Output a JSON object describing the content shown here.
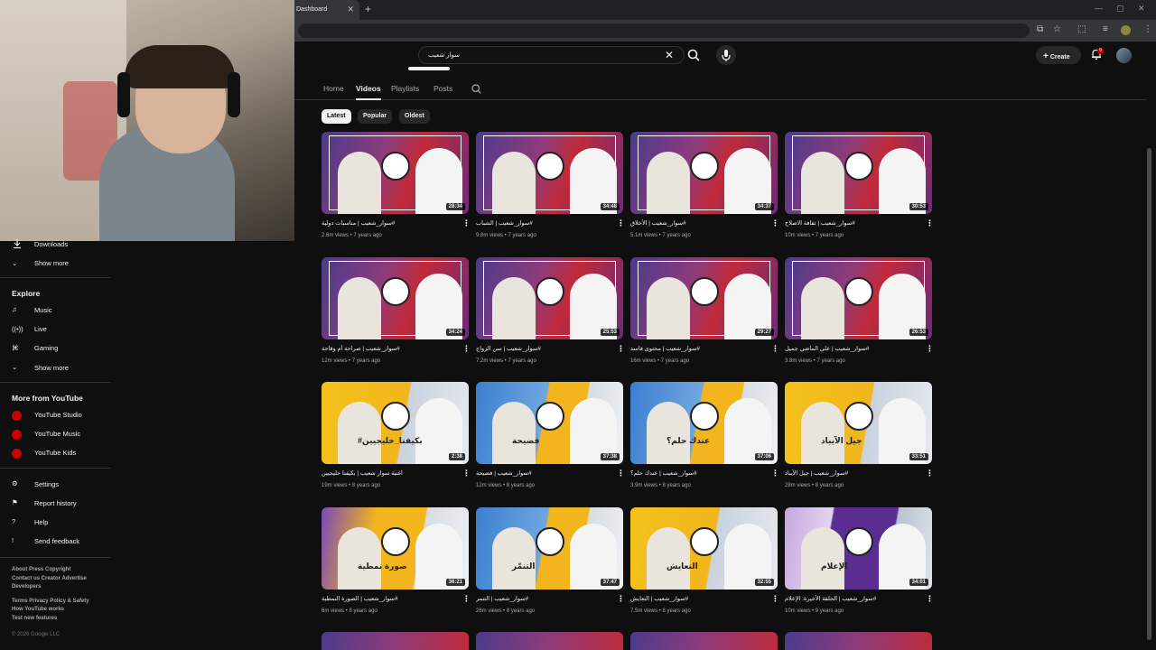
{
  "browser": {
    "tab_title": "Dashboard",
    "tab_close": "✕",
    "new_tab": "+"
  },
  "header": {
    "search_query": "سوار شعيب",
    "create_label": "Create",
    "notification_count": "9"
  },
  "channel_tabs": [
    "Home",
    "Videos",
    "Playlists",
    "Posts"
  ],
  "active_tab": "Videos",
  "chips": [
    "Latest",
    "Popular",
    "Oldest"
  ],
  "sidebar": {
    "downloads": "Downloads",
    "show_more_1": "Show more",
    "explore_heading": "Explore",
    "explore_items": [
      "Music",
      "Live",
      "Gaming"
    ],
    "show_more_2": "Show more",
    "more_heading": "More from YouTube",
    "more_items": [
      "YouTube Studio",
      "YouTube Music",
      "YouTube Kids"
    ],
    "settings_items": [
      "Settings",
      "Report history",
      "Help",
      "Send feedback"
    ],
    "footer_1": "About  Press  Copyright",
    "footer_2": "Contact us  Creator  Advertise",
    "footer_3": "Developers",
    "footer_4": "Terms  Privacy  Policy & Safety",
    "footer_5": "How YouTube works",
    "footer_6": "Test new features",
    "copyright": "© 2026 Google LLC"
  },
  "videos": [
    {
      "title": "#سوار_شعيب | مناسبات دولية",
      "meta": "2.6m views • 7 years ago",
      "duration": "28:34",
      "style": "red"
    },
    {
      "title": "#سوار_شعيب | الشباب",
      "meta": "9.8m views • 7 years ago",
      "duration": "34:48",
      "style": "red"
    },
    {
      "title": "#سوار_شعيب | الأخلاق",
      "meta": "5.1m views • 7 years ago",
      "duration": "34:37",
      "style": "red"
    },
    {
      "title": "#سوار_شعيب | ثقافة الاصلاح",
      "meta": "10m views • 7 years ago",
      "duration": "30:53",
      "style": "red"
    },
    {
      "title": "#سوار_شعيب | صراحة أم وقاحة",
      "meta": "12m views • 7 years ago",
      "duration": "34:24",
      "style": "red"
    },
    {
      "title": "#سوار_شعيب | سن الزواج",
      "meta": "7.2m views • 7 years ago",
      "duration": "25:53",
      "style": "red"
    },
    {
      "title": "#سوار_شعيب | محتوى فاسد",
      "meta": "16m views • 7 years ago",
      "duration": "29:27",
      "style": "red"
    },
    {
      "title": "#سوار_شعيب | على الماضي جميل",
      "meta": "3.8m views • 7 years ago",
      "duration": "26:53",
      "style": "red"
    },
    {
      "title": "اغنية سوار شعيب | بكيفنا خليجيين",
      "meta": "19m views • 8 years ago",
      "duration": "2:38",
      "style": "yellow",
      "overlay": "#بكيفنا_خليجيين"
    },
    {
      "title": "#سوار_شعيب | فضيحة",
      "meta": "12m views • 8 years ago",
      "duration": "37:38",
      "style": "blue",
      "overlay": "فضيحة"
    },
    {
      "title": "#سوار_شعيب | عندك حلم؟",
      "meta": "3.9m views • 8 years ago",
      "duration": "37:06",
      "style": "blue",
      "overlay": "عندك حلم؟"
    },
    {
      "title": "#سوار_شعيب | جيل الآيباد",
      "meta": "28m views • 8 years ago",
      "duration": "33:51",
      "style": "yellow",
      "overlay": "جيل الآيباد"
    },
    {
      "title": "#سوار_شعيب | الصورة النمطية",
      "meta": "6m views • 8 years ago",
      "duration": "36:21",
      "style": "purple",
      "overlay": "صورة نمطية"
    },
    {
      "title": "#سوار_شعيب | التنمر",
      "meta": "26m views • 8 years ago",
      "duration": "37:47",
      "style": "blue",
      "overlay": "التنمّر"
    },
    {
      "title": "#سوار_شعيب | التعايش",
      "meta": "7.5m views • 8 years ago",
      "duration": "32:55",
      "style": "yellow",
      "overlay": "التعايش"
    },
    {
      "title": "#سوار_شعيب | الحلقة الأخيرة: الإعلام",
      "meta": "10m views • 9 years ago",
      "duration": "34:01",
      "style": "violet",
      "overlay": "الإعلام"
    }
  ],
  "colors": {
    "bg": "#0f0f0f",
    "red": "#cc0000",
    "yellow": "#f2b51d",
    "purple": "#5b2d91"
  }
}
